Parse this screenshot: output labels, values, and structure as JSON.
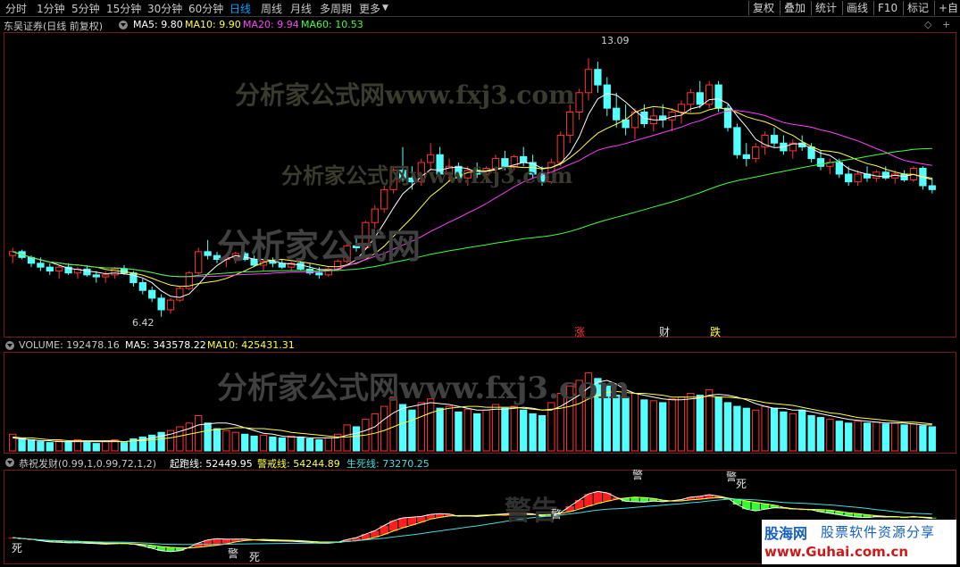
{
  "toolbar": {
    "periods": [
      "分时",
      "1分钟",
      "5分钟",
      "15分钟",
      "30分钟",
      "60分钟",
      "日线",
      "周线",
      "月线",
      "多周期",
      "更多"
    ],
    "active_period": "日线",
    "right_buttons": [
      "复权",
      "叠加",
      "统计",
      "画线",
      "F10",
      "标记",
      "+自"
    ]
  },
  "main_info": {
    "stock": "东吴证券(日线 前复权)",
    "ma5": "MA5: 9.80",
    "ma10": "MA10: 9.90",
    "ma20": "MA20: 9.94",
    "ma60": "MA60: 10.53",
    "colors": {
      "ma5": "#ffffff",
      "ma10": "#ffff40",
      "ma20": "#ff40ff",
      "ma60": "#40ff40"
    }
  },
  "price_labels": {
    "high": "13.09",
    "low": "6.42"
  },
  "event_markers": [
    {
      "text": "涨",
      "color": "#ff3030"
    },
    {
      "text": "财",
      "color": "#e0e0e0"
    },
    {
      "text": "跌",
      "color": "#ffff40"
    }
  ],
  "volume_info": {
    "volume": "VOLUME: 192478.16",
    "ma5": "MA5: 343578.22",
    "ma10": "MA10: 425431.31"
  },
  "indicator_info": {
    "name": "恭祝发财(0.99,1,0.99,72,1,2)",
    "line1": "起跑线: 52449.95",
    "line2": "警戒线: 54244.89",
    "line3": "生死线: 73270.25"
  },
  "indicator_marks": [
    "死",
    "警",
    "死",
    "警",
    "警",
    "警",
    "死"
  ],
  "watermarks": [
    "分析家公式网www.fxj3.com",
    "分析家公式网www.fxj3.com",
    "分析家公式网",
    "分析家公式网www.fxj3.com",
    "警告"
  ],
  "logo": {
    "line1a": "股海网",
    "line1b": "股票软件资源分享",
    "line2": "www.Guhai.com.cn"
  },
  "chart_data": {
    "type": "candlestick",
    "note_scale": "price",
    "ylim": [
      6.0,
      13.6
    ],
    "candles": [
      [
        8.0,
        8.2,
        7.8,
        8.1
      ],
      [
        8.1,
        8.15,
        7.9,
        7.95
      ],
      [
        7.95,
        8.0,
        7.7,
        7.8
      ],
      [
        7.8,
        7.95,
        7.6,
        7.7
      ],
      [
        7.7,
        7.8,
        7.5,
        7.6
      ],
      [
        7.6,
        7.75,
        7.4,
        7.7
      ],
      [
        7.7,
        7.8,
        7.5,
        7.55
      ],
      [
        7.55,
        7.7,
        7.4,
        7.65
      ],
      [
        7.65,
        7.75,
        7.45,
        7.5
      ],
      [
        7.5,
        7.6,
        7.3,
        7.45
      ],
      [
        7.45,
        7.6,
        7.3,
        7.5
      ],
      [
        7.5,
        7.7,
        7.4,
        7.65
      ],
      [
        7.65,
        7.75,
        7.5,
        7.55
      ],
      [
        7.55,
        7.6,
        7.2,
        7.3
      ],
      [
        7.3,
        7.4,
        7.0,
        7.1
      ],
      [
        7.1,
        7.2,
        6.8,
        6.9
      ],
      [
        6.9,
        7.0,
        6.42,
        6.6
      ],
      [
        6.6,
        6.9,
        6.5,
        6.85
      ],
      [
        6.85,
        7.2,
        6.8,
        7.15
      ],
      [
        7.15,
        7.6,
        7.1,
        7.55
      ],
      [
        7.55,
        8.2,
        7.5,
        8.1
      ],
      [
        8.1,
        8.4,
        7.9,
        8.0
      ],
      [
        8.0,
        8.1,
        7.8,
        7.9
      ],
      [
        7.9,
        8.0,
        7.7,
        7.95
      ],
      [
        7.95,
        8.1,
        7.8,
        8.05
      ],
      [
        8.05,
        8.1,
        7.85,
        7.9
      ],
      [
        7.9,
        8.0,
        7.7,
        7.75
      ],
      [
        7.75,
        7.9,
        7.6,
        7.85
      ],
      [
        7.85,
        7.95,
        7.7,
        7.8
      ],
      [
        7.8,
        7.9,
        7.65,
        7.7
      ],
      [
        7.7,
        7.85,
        7.6,
        7.8
      ],
      [
        7.8,
        7.9,
        7.6,
        7.65
      ],
      [
        7.65,
        7.8,
        7.5,
        7.55
      ],
      [
        7.55,
        7.7,
        7.4,
        7.5
      ],
      [
        7.5,
        7.7,
        7.45,
        7.65
      ],
      [
        7.65,
        7.9,
        7.6,
        7.85
      ],
      [
        7.85,
        8.3,
        7.8,
        8.25
      ],
      [
        8.25,
        8.5,
        8.1,
        8.2
      ],
      [
        8.2,
        8.9,
        8.15,
        8.85
      ],
      [
        8.85,
        9.3,
        8.7,
        9.2
      ],
      [
        9.2,
        9.8,
        9.1,
        9.7
      ],
      [
        9.7,
        10.3,
        9.6,
        10.2
      ],
      [
        10.2,
        10.8,
        9.9,
        10.0
      ],
      [
        10.0,
        10.3,
        9.7,
        9.9
      ],
      [
        9.9,
        10.5,
        9.8,
        10.4
      ],
      [
        10.4,
        10.9,
        10.2,
        10.6
      ],
      [
        10.6,
        10.8,
        10.0,
        10.1
      ],
      [
        10.1,
        10.5,
        9.9,
        10.3
      ],
      [
        10.3,
        10.4,
        9.9,
        10.0
      ],
      [
        10.0,
        10.3,
        9.8,
        10.2
      ],
      [
        10.2,
        10.4,
        10.0,
        10.1
      ],
      [
        10.1,
        10.3,
        9.9,
        10.25
      ],
      [
        10.25,
        10.6,
        10.1,
        10.5
      ],
      [
        10.5,
        10.7,
        10.2,
        10.3
      ],
      [
        10.3,
        10.6,
        10.2,
        10.55
      ],
      [
        10.55,
        10.8,
        10.3,
        10.4
      ],
      [
        10.4,
        10.6,
        10.0,
        10.1
      ],
      [
        10.1,
        10.3,
        9.8,
        9.9
      ],
      [
        9.9,
        10.5,
        9.85,
        10.4
      ],
      [
        10.4,
        11.2,
        10.3,
        11.1
      ],
      [
        11.1,
        11.9,
        10.9,
        11.7
      ],
      [
        11.7,
        12.3,
        11.5,
        12.2
      ],
      [
        12.2,
        13.09,
        12.0,
        12.8
      ],
      [
        12.8,
        13.0,
        12.2,
        12.4
      ],
      [
        12.4,
        12.6,
        11.6,
        11.8
      ],
      [
        11.8,
        12.2,
        11.3,
        11.5
      ],
      [
        11.5,
        11.9,
        11.1,
        11.3
      ],
      [
        11.3,
        11.8,
        11.0,
        11.7
      ],
      [
        11.7,
        11.9,
        11.3,
        11.4
      ],
      [
        11.4,
        11.8,
        11.2,
        11.6
      ],
      [
        11.6,
        11.9,
        11.3,
        11.5
      ],
      [
        11.5,
        11.8,
        11.2,
        11.7
      ],
      [
        11.7,
        12.0,
        11.4,
        11.9
      ],
      [
        11.9,
        12.3,
        11.7,
        12.2
      ],
      [
        12.2,
        12.5,
        11.8,
        11.9
      ],
      [
        11.9,
        12.5,
        11.8,
        12.4
      ],
      [
        12.4,
        12.5,
        11.7,
        11.8
      ],
      [
        11.8,
        11.9,
        11.2,
        11.3
      ],
      [
        11.3,
        11.4,
        10.5,
        10.6
      ],
      [
        10.6,
        10.9,
        10.3,
        10.5
      ],
      [
        10.5,
        10.9,
        10.4,
        10.8
      ],
      [
        10.8,
        11.2,
        10.6,
        11.1
      ],
      [
        11.1,
        11.3,
        10.8,
        10.9
      ],
      [
        10.9,
        11.1,
        10.6,
        10.7
      ],
      [
        10.7,
        11.0,
        10.5,
        10.9
      ],
      [
        10.9,
        11.1,
        10.7,
        10.8
      ],
      [
        10.8,
        10.9,
        10.4,
        10.5
      ],
      [
        10.5,
        10.7,
        10.2,
        10.3
      ],
      [
        10.3,
        10.5,
        10.1,
        10.4
      ],
      [
        10.4,
        10.5,
        10.0,
        10.1
      ],
      [
        10.1,
        10.3,
        9.8,
        9.9
      ],
      [
        9.9,
        10.2,
        9.8,
        10.1
      ],
      [
        10.1,
        10.3,
        9.9,
        10.0
      ],
      [
        10.0,
        10.2,
        9.9,
        10.15
      ],
      [
        10.15,
        10.3,
        9.95,
        10.0
      ],
      [
        10.0,
        10.2,
        9.85,
        10.1
      ],
      [
        10.1,
        10.2,
        9.9,
        9.95
      ],
      [
        9.95,
        10.3,
        9.9,
        10.25
      ],
      [
        10.25,
        10.3,
        9.7,
        9.8
      ],
      [
        9.8,
        10.0,
        9.6,
        9.7
      ]
    ],
    "volume_ylim": [
      0,
      100
    ],
    "volumes": [
      18,
      14,
      12,
      10,
      9,
      11,
      10,
      12,
      9,
      8,
      10,
      12,
      9,
      13,
      15,
      17,
      20,
      22,
      26,
      30,
      38,
      30,
      24,
      22,
      20,
      18,
      16,
      17,
      15,
      14,
      16,
      15,
      13,
      12,
      14,
      18,
      28,
      26,
      34,
      40,
      48,
      58,
      50,
      44,
      52,
      56,
      46,
      48,
      42,
      45,
      40,
      44,
      50,
      46,
      48,
      44,
      40,
      38,
      52,
      62,
      70,
      76,
      84,
      78,
      70,
      60,
      58,
      62,
      55,
      54,
      52,
      56,
      58,
      62,
      60,
      66,
      58,
      52,
      48,
      46,
      44,
      48,
      46,
      42,
      40,
      44,
      38,
      36,
      34,
      32,
      30,
      32,
      30,
      31,
      29,
      30,
      28,
      29,
      27,
      26
    ],
    "volume_ma5": [
      14,
      13,
      12,
      11,
      11,
      10,
      10,
      10,
      10,
      10,
      10,
      10,
      10,
      11,
      12,
      14,
      16,
      18,
      21,
      24,
      28,
      29,
      30,
      30,
      28,
      25,
      22,
      19,
      18,
      16,
      15,
      15,
      14,
      14,
      14,
      14,
      17,
      19,
      22,
      26,
      34,
      41,
      46,
      48,
      50,
      52,
      51,
      50,
      48,
      46,
      44,
      44,
      45,
      45,
      46,
      47,
      46,
      44,
      44,
      48,
      54,
      60,
      68,
      74,
      76,
      72,
      66,
      62,
      60,
      58,
      56,
      55,
      55,
      56,
      57,
      60,
      61,
      60,
      58,
      55,
      51,
      48,
      46,
      46,
      44,
      44,
      42,
      40,
      38,
      36,
      34,
      33,
      32,
      31,
      30,
      30,
      30,
      29,
      28,
      28
    ],
    "volume_ma10": [
      15,
      14,
      14,
      13,
      12,
      12,
      11,
      11,
      11,
      11,
      11,
      11,
      10,
      11,
      11,
      12,
      13,
      14,
      16,
      18,
      20,
      22,
      23,
      24,
      25,
      25,
      24,
      24,
      23,
      22,
      20,
      19,
      18,
      17,
      16,
      15,
      15,
      16,
      17,
      19,
      22,
      26,
      30,
      33,
      37,
      41,
      44,
      46,
      47,
      48,
      48,
      47,
      47,
      47,
      47,
      46,
      45,
      44,
      45,
      46,
      48,
      51,
      56,
      60,
      63,
      64,
      63,
      62,
      62,
      61,
      60,
      58,
      58,
      58,
      58,
      59,
      58,
      58,
      57,
      56,
      54,
      52,
      51,
      50,
      49,
      47,
      45,
      43,
      41,
      40,
      38,
      36,
      35,
      34,
      33,
      32,
      31,
      31,
      30,
      29
    ]
  }
}
